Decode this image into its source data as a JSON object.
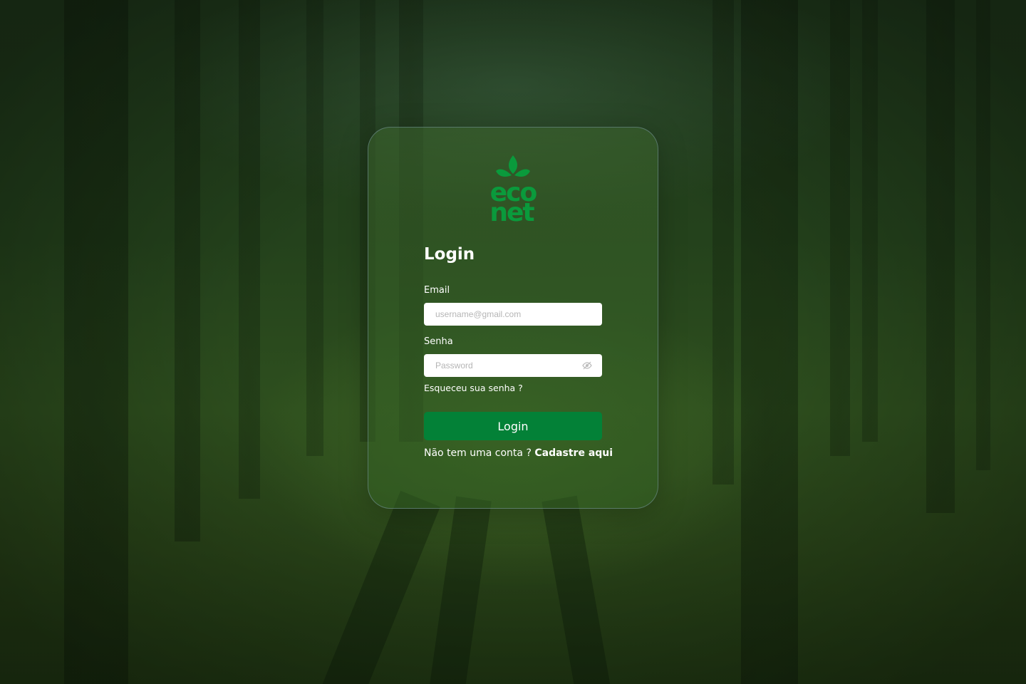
{
  "brand": {
    "logo_text_top": "eco",
    "logo_text_bottom": "net",
    "logo_color": "#0a9a3c"
  },
  "login": {
    "title": "Login",
    "email_label": "Email",
    "email_placeholder": "username@gmail.com",
    "password_label": "Senha",
    "password_placeholder": "Password",
    "forgot_password": "Esqueceu sua senha ?",
    "submit_label": "Login",
    "signup_prompt": "Não tem uma conta ?",
    "signup_link": "Cadastre aqui"
  },
  "colors": {
    "button": "#038137",
    "text": "#ffffff"
  },
  "icons": {
    "password_toggle": "eye-off-icon"
  }
}
